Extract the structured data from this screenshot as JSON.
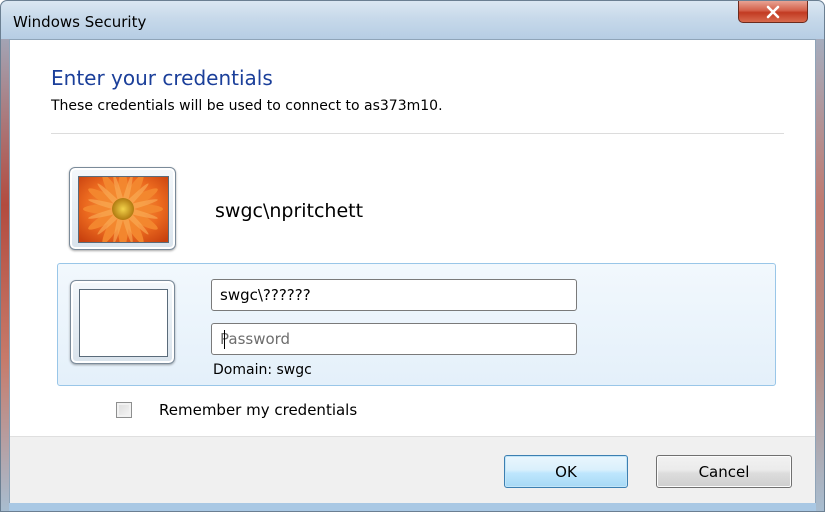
{
  "window": {
    "title": "Windows Security"
  },
  "dialog": {
    "heading": "Enter your credentials",
    "subheading": "These credentials will be used to connect to as373m10."
  },
  "saved_user": {
    "name": "swgc\\npritchett"
  },
  "other_user": {
    "username_value": "swgc\\??????",
    "password_placeholder": "Password",
    "domain_text": "Domain: swgc"
  },
  "remember": {
    "label": "Remember my credentials",
    "checked": false
  },
  "buttons": {
    "ok": "OK",
    "cancel": "Cancel"
  },
  "colors": {
    "heading": "#1b3f9a",
    "selected_panel_border": "#99c6e8",
    "close_button": "#c23a22"
  }
}
